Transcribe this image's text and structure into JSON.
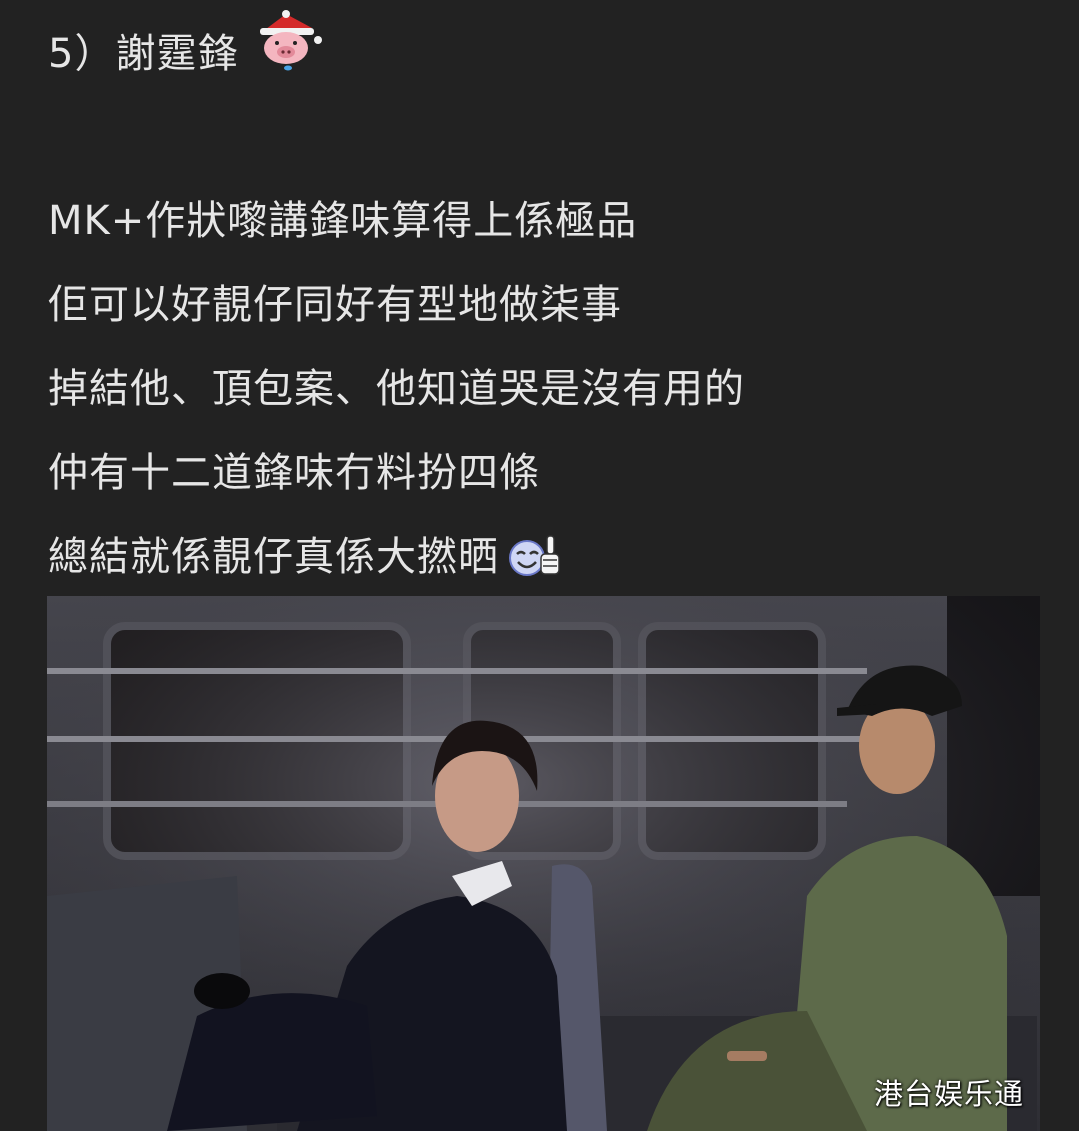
{
  "post": {
    "heading": "5）謝霆鋒",
    "heading_emoji": "pig-christmas-hat-emoji",
    "lines": [
      "MK+作狀嚟講鋒味算得上係極品",
      "佢可以好靚仔同好有型地做柒事",
      "掉結他、頂包案、他知道哭是沒有用的",
      "仲有十二道鋒味冇料扮四條",
      "總結就係靚仔真係大撚晒"
    ],
    "line_end_emoji": "smile-thumbs-up-emoji"
  },
  "photo": {
    "subject": "two-men-in-van-photo",
    "watermark": "港台娱乐通"
  },
  "colors": {
    "background": "#222222",
    "text": "#e6e6e6"
  }
}
